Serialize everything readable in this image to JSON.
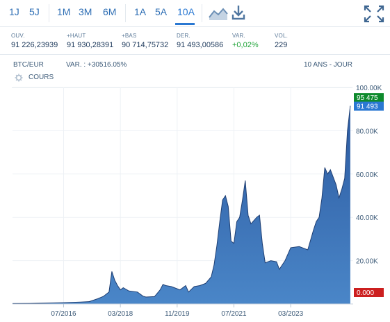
{
  "toolbar": {
    "ranges": [
      "1J",
      "5J",
      "1M",
      "3M",
      "6M",
      "1A",
      "5A",
      "10A"
    ],
    "active_range": "10A",
    "icons": [
      "area-chart-icon",
      "download-icon",
      "fullscreen-icon"
    ]
  },
  "stats": [
    {
      "label": "OUV.",
      "value": "91 226,23939"
    },
    {
      "label": "+HAUT",
      "value": "91 930,28391"
    },
    {
      "label": "+BAS",
      "value": "90 714,75732"
    },
    {
      "label": "DER.",
      "value": "91 493,00586"
    },
    {
      "label": "VAR.",
      "value": "+0,02%"
    },
    {
      "label": "VOL.",
      "value": "229"
    }
  ],
  "chart_header": {
    "symbol": "BTC/EUR",
    "variation": "VAR. : +30516.05%",
    "period": "10 ANS - JOUR"
  },
  "legend": {
    "label": "COURS",
    "icon": "gear-icon"
  },
  "colors": {
    "area_fill_top": "#2c5aa0",
    "area_fill_bottom": "#4a86c8",
    "line": "#1f3f73",
    "badge_high": "#0e8a2c",
    "badge_last": "#2a78d2",
    "badge_zero": "#cc1f1f",
    "accent": "#2a78d2"
  },
  "chart_data": {
    "type": "area",
    "x_ticks": [
      "07/2016",
      "03/2018",
      "11/2019",
      "07/2021",
      "03/2023"
    ],
    "y_ticks": [
      "100.00K",
      "80.00K",
      "60.00K",
      "40.00K",
      "20.00K"
    ],
    "ylim": [
      0,
      100000
    ],
    "price_badges": [
      {
        "label": "95 475",
        "value": 95475,
        "color": "badge_high"
      },
      {
        "label": "91 493",
        "value": 91493,
        "color": "badge_last"
      },
      {
        "label": "0.000",
        "value": 0,
        "color": "badge_zero"
      }
    ],
    "x_start": "2015-01",
    "x_end": "2025-01",
    "series": [
      {
        "x": [
          "2015-01",
          "2015-07",
          "2016-01",
          "2016-07",
          "2017-01",
          "2017-04",
          "2017-07",
          "2017-09",
          "2017-11",
          "2017-12",
          "2018-01",
          "2018-02",
          "2018-03",
          "2018-04",
          "2018-06",
          "2018-09",
          "2018-11",
          "2018-12",
          "2019-03",
          "2019-05",
          "2019-06",
          "2019-07",
          "2019-09",
          "2019-12",
          "2020-02",
          "2020-03",
          "2020-05",
          "2020-07",
          "2020-09",
          "2020-11",
          "2020-12",
          "2021-01",
          "2021-02",
          "2021-03",
          "2021-04",
          "2021-05",
          "2021-06",
          "2021-07",
          "2021-08",
          "2021-09",
          "2021-10",
          "2021-11",
          "2021-12",
          "2022-01",
          "2022-03",
          "2022-04",
          "2022-05",
          "2022-06",
          "2022-08",
          "2022-10",
          "2022-11",
          "2023-01",
          "2023-03",
          "2023-06",
          "2023-09",
          "2023-11",
          "2023-12",
          "2024-01",
          "2024-02",
          "2024-03",
          "2024-04",
          "2024-05",
          "2024-07",
          "2024-08",
          "2024-09",
          "2024-10",
          "2024-11",
          "2024-12"
        ],
        "values": [
          200,
          250,
          380,
          600,
          900,
          1100,
          2400,
          3500,
          5500,
          15000,
          11000,
          8500,
          6500,
          7500,
          6000,
          5500,
          3600,
          3200,
          3400,
          6500,
          9000,
          8500,
          8000,
          6500,
          8500,
          5500,
          8000,
          8500,
          9500,
          12500,
          18000,
          27000,
          38000,
          48000,
          50000,
          45000,
          29000,
          28000,
          38000,
          40000,
          48000,
          57000,
          41000,
          37000,
          40000,
          41000,
          28000,
          19000,
          20000,
          19500,
          16000,
          20000,
          26000,
          26500,
          25000,
          34000,
          38000,
          40000,
          49000,
          63000,
          60000,
          62000,
          55000,
          49000,
          53000,
          58000,
          80000,
          91493
        ]
      }
    ]
  }
}
